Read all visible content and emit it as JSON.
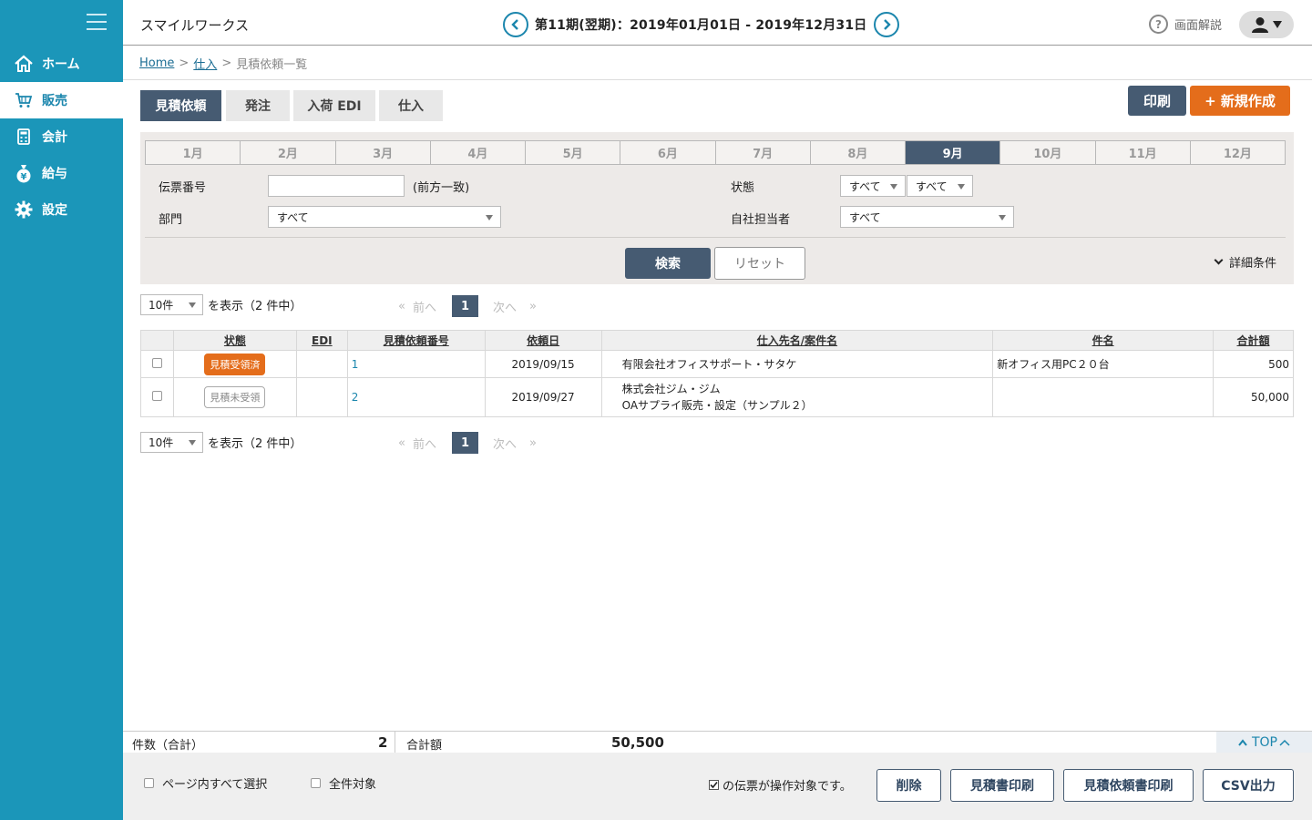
{
  "sidebar": {
    "items": [
      {
        "label": "ホーム",
        "icon": "home-icon"
      },
      {
        "label": "販売",
        "icon": "cart-icon"
      },
      {
        "label": "会計",
        "icon": "calculator-icon"
      },
      {
        "label": "給与",
        "icon": "money-bag-icon"
      },
      {
        "label": "設定",
        "icon": "gear-icon"
      }
    ],
    "active_index": 1
  },
  "header": {
    "app_title": "スマイルワークス",
    "period": "第11期(翌期)：2019年01月01日 - 2019年12月31日",
    "help_label": "画面解説"
  },
  "breadcrumb": {
    "home": "Home",
    "section": "仕入",
    "current": "見積依頼一覧",
    "separator": ">"
  },
  "tabs": [
    "見積依頼",
    "発注",
    "入荷 EDI",
    "仕入"
  ],
  "toolbar": {
    "print_label": "印刷",
    "new_label": "+ 新規作成"
  },
  "colors": {
    "sidebar": "#1b96b9",
    "primary": "#465b72",
    "accent": "#e46d1b",
    "link": "#1b86ad"
  },
  "filter": {
    "months": [
      "1月",
      "2月",
      "3月",
      "4月",
      "5月",
      "6月",
      "7月",
      "8月",
      "9月",
      "10月",
      "11月",
      "12月"
    ],
    "active_month": "9月",
    "slip_no_label": "伝票番号",
    "slip_no_value": "",
    "slip_no_hint": "(前方一致)",
    "dept_label": "部門",
    "dept_value": "すべて",
    "status_label": "状態",
    "status_value_1": "すべて",
    "status_value_2": "すべて",
    "staff_label": "自社担当者",
    "staff_value": "すべて",
    "search_label": "検索",
    "reset_label": "リセット",
    "detail_label": "詳細条件"
  },
  "pager": {
    "per_page": "10件",
    "show_text": "を表示（2 件中）",
    "first": "«",
    "prev": "前へ",
    "current": "1",
    "next": "次へ",
    "last": "»"
  },
  "table": {
    "headers": [
      "状態",
      "EDI",
      "見積依頼番号",
      "依頼日",
      "仕入先名/案件名",
      "件名",
      "合計額"
    ],
    "rows": [
      {
        "status": "見積受領済",
        "status_type": "done",
        "edi": "",
        "number": "1",
        "date": "2019/09/15",
        "supplier": "有限会社オフィスサポート・サタケ",
        "project": "",
        "subject": "新オフィス用PC２０台",
        "total": "500"
      },
      {
        "status": "見積未受領",
        "status_type": "not",
        "edi": "",
        "number": "2",
        "date": "2019/09/27",
        "supplier": "株式会社ジム・ジム",
        "project": "OAサプライ販売・設定（サンプル２）",
        "subject": "",
        "total": "50,000"
      }
    ]
  },
  "summary": {
    "count_label": "件数（合計）",
    "count_value": "2",
    "total_label": "合計額",
    "total_value": "50,500",
    "top_label": "TOP"
  },
  "actions": {
    "select_page_label": "ページ内すべて選択",
    "all_label": "全件対象",
    "note": "の伝票が操作対象です。",
    "delete_label": "削除",
    "estimate_print_label": "見積書印刷",
    "request_print_label": "見積依頼書印刷",
    "csv_label": "CSV出力"
  }
}
